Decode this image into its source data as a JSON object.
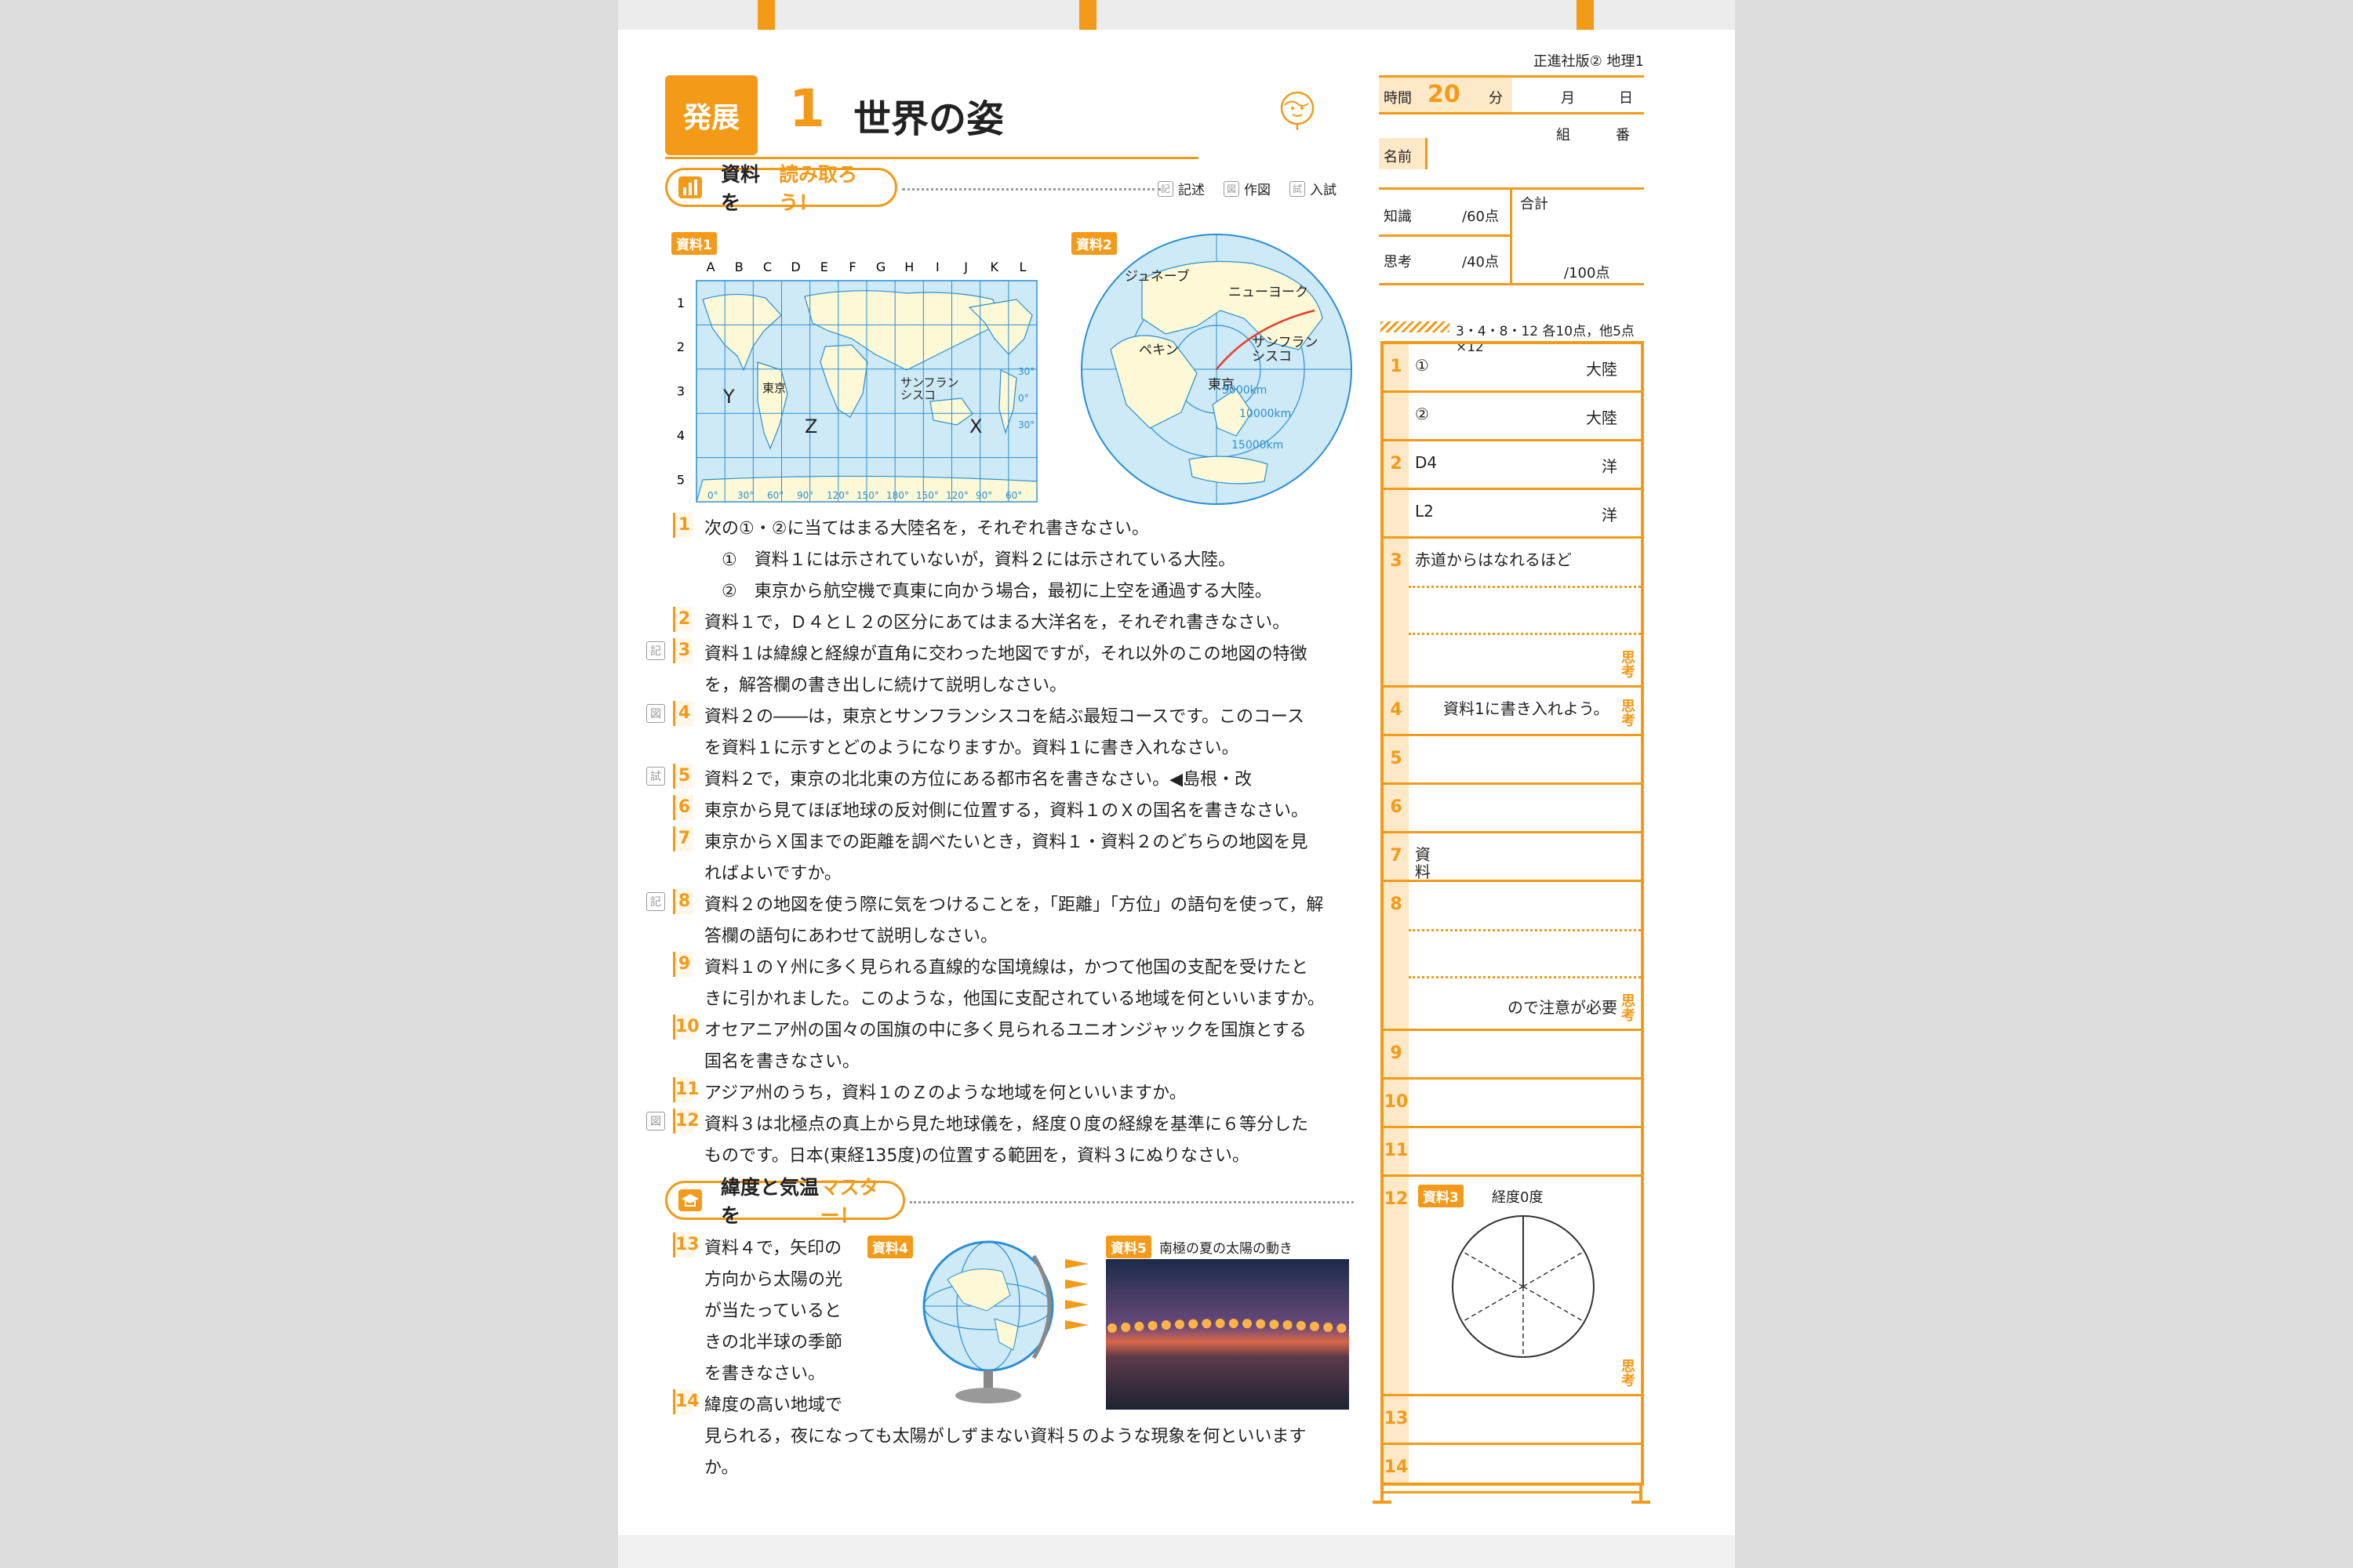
{
  "header": {
    "badge": "発展",
    "number": "1",
    "title": "世界の姿",
    "publisher": "正進社版② 地理1",
    "time_label": "時間",
    "time_value": "20",
    "time_unit": "分",
    "month": "月",
    "day": "日",
    "class": "組",
    "seat": "番",
    "name_label": "名前",
    "knowledge_label": "知識",
    "knowledge_score": "/60点",
    "thinking_label": "思考",
    "thinking_score": "/40点",
    "total_label": "合計",
    "total_score": "/100点"
  },
  "section1": {
    "title_plain": "資料を",
    "title_accent": "読み取ろう！",
    "legend": [
      {
        "icon": "記",
        "label": "記述"
      },
      {
        "icon": "図",
        "label": "作図"
      },
      {
        "icon": "試",
        "label": "入試"
      }
    ]
  },
  "map1": {
    "tag": "資料1",
    "cols": [
      "A",
      "B",
      "C",
      "D",
      "E",
      "F",
      "G",
      "H",
      "I",
      "J",
      "K",
      "L"
    ],
    "rows": [
      "1",
      "2",
      "3",
      "4",
      "5"
    ],
    "labels": {
      "tokyo": "東京",
      "sf": "サンフラン\nシスコ",
      "y": "Y",
      "z": "Z",
      "x": "X"
    },
    "lons": [
      "0°",
      "30°",
      "60°",
      "90°",
      "120°",
      "150°",
      "180°",
      "150°",
      "120°",
      "90°",
      "60°"
    ],
    "lats": [
      "30°",
      "0°",
      "30°"
    ]
  },
  "map2": {
    "tag": "資料2",
    "labels": {
      "geneva": "ジュネーブ",
      "ny": "ニューヨーク",
      "beijing": "ペキン",
      "sf": "サンフラン\nシスコ",
      "tokyo": "東京",
      "r1": "5000km",
      "r2": "10000km",
      "r3": "15000km"
    }
  },
  "questions": [
    {
      "num": "1",
      "mark": "",
      "lines": [
        "次の①・②に当てはまる大陸名を，それぞれ書きなさい。",
        "　①　資料１には示されていないが，資料２には示されている大陸。",
        "　②　東京から航空機で真東に向かう場合，最初に上空を通過する大陸。"
      ]
    },
    {
      "num": "2",
      "mark": "",
      "lines": [
        "資料１で，Ｄ４とＬ２の区分にあてはまる大洋名を，それぞれ書きなさい。"
      ]
    },
    {
      "num": "3",
      "mark": "記",
      "lines": [
        "資料１は緯線と経線が直角に交わった地図ですが，それ以外のこの地図の特徴",
        "を，解答欄の書き出しに続けて説明しなさい。"
      ]
    },
    {
      "num": "4",
      "mark": "図",
      "lines": [
        "資料２の――は，東京とサンフランシスコを結ぶ最短コースです。このコース",
        "を資料１に示すとどのようになりますか。資料１に書き入れなさい。"
      ]
    },
    {
      "num": "5",
      "mark": "試",
      "lines": [
        "資料２で，東京の北北東の方位にある都市名を書きなさい。◀島根・改"
      ]
    },
    {
      "num": "6",
      "mark": "",
      "lines": [
        "東京から見てほぼ地球の反対側に位置する，資料１のＸの国名を書きなさい。"
      ]
    },
    {
      "num": "7",
      "mark": "",
      "lines": [
        "東京からＸ国までの距離を調べたいとき，資料１・資料２のどちらの地図を見",
        "ればよいですか。"
      ]
    },
    {
      "num": "8",
      "mark": "記",
      "lines": [
        "資料２の地図を使う際に気をつけることを，「距離」「方位」の語句を使って，解",
        "答欄の語句にあわせて説明しなさい。"
      ]
    },
    {
      "num": "9",
      "mark": "",
      "lines": [
        "資料１のＹ州に多く見られる直線的な国境線は，かつて他国の支配を受けたと",
        "きに引かれました。このような，他国に支配されている地域を何といいますか。"
      ]
    },
    {
      "num": "10",
      "mark": "",
      "lines": [
        "オセアニア州の国々の国旗の中に多く見られるユニオンジャックを国旗とする",
        "国名を書きなさい。"
      ]
    },
    {
      "num": "11",
      "mark": "",
      "lines": [
        "アジア州のうち，資料１のＺのような地域を何といいますか。"
      ]
    },
    {
      "num": "12",
      "mark": "図",
      "lines": [
        "資料３は北極点の真上から見た地球儀を，経度０度の経線を基準に６等分した",
        "ものです。日本(東経135度)の位置する範囲を，資料３にぬりなさい。"
      ]
    }
  ],
  "section2": {
    "title_plain": "緯度と気温を",
    "title_accent": "マスター！"
  },
  "questions2": [
    {
      "num": "13",
      "lines": [
        "資料４で，矢印の",
        "方向から太陽の光",
        "が当たっていると",
        "きの北半球の季節",
        "を書きなさい。"
      ]
    },
    {
      "num": "14",
      "lines": [
        "緯度の高い地域で",
        "見られる，夜になっても太陽がしずまない資料５のような現象を何といいます",
        "か。"
      ]
    }
  ],
  "fig4": {
    "tag": "資料4"
  },
  "fig5": {
    "tag": "資料5",
    "caption": "南極の夏の太陽の動き"
  },
  "answer": {
    "points": "3・4・8・12 各10点，他5点×12",
    "rows": [
      {
        "num": "1",
        "text": "①",
        "suffix": "大陸"
      },
      {
        "num": "",
        "text": "②",
        "suffix": "大陸"
      },
      {
        "num": "2",
        "text": "D4",
        "suffix": "洋"
      },
      {
        "num": "",
        "text": "L2",
        "suffix": "洋"
      },
      {
        "num": "3",
        "text": "赤道からはなれるほど",
        "suffix": ""
      },
      {
        "num": "4",
        "text": "資料1に書き入れよう。",
        "suffix": ""
      },
      {
        "num": "5",
        "text": "",
        "suffix": ""
      },
      {
        "num": "6",
        "text": "",
        "suffix": ""
      },
      {
        "num": "7",
        "text": "資\n料",
        "suffix": ""
      },
      {
        "num": "8",
        "text": "",
        "suffix": "ので注意が必要"
      },
      {
        "num": "9",
        "text": "",
        "suffix": ""
      },
      {
        "num": "10",
        "text": "",
        "suffix": ""
      },
      {
        "num": "11",
        "text": "",
        "suffix": ""
      },
      {
        "num": "12",
        "text": "",
        "suffix": ""
      },
      {
        "num": "13",
        "text": "",
        "suffix": ""
      },
      {
        "num": "14",
        "text": "",
        "suffix": ""
      }
    ],
    "shikou": "思考",
    "fig3_tag": "資料3",
    "fig3_label": "経度0度"
  }
}
